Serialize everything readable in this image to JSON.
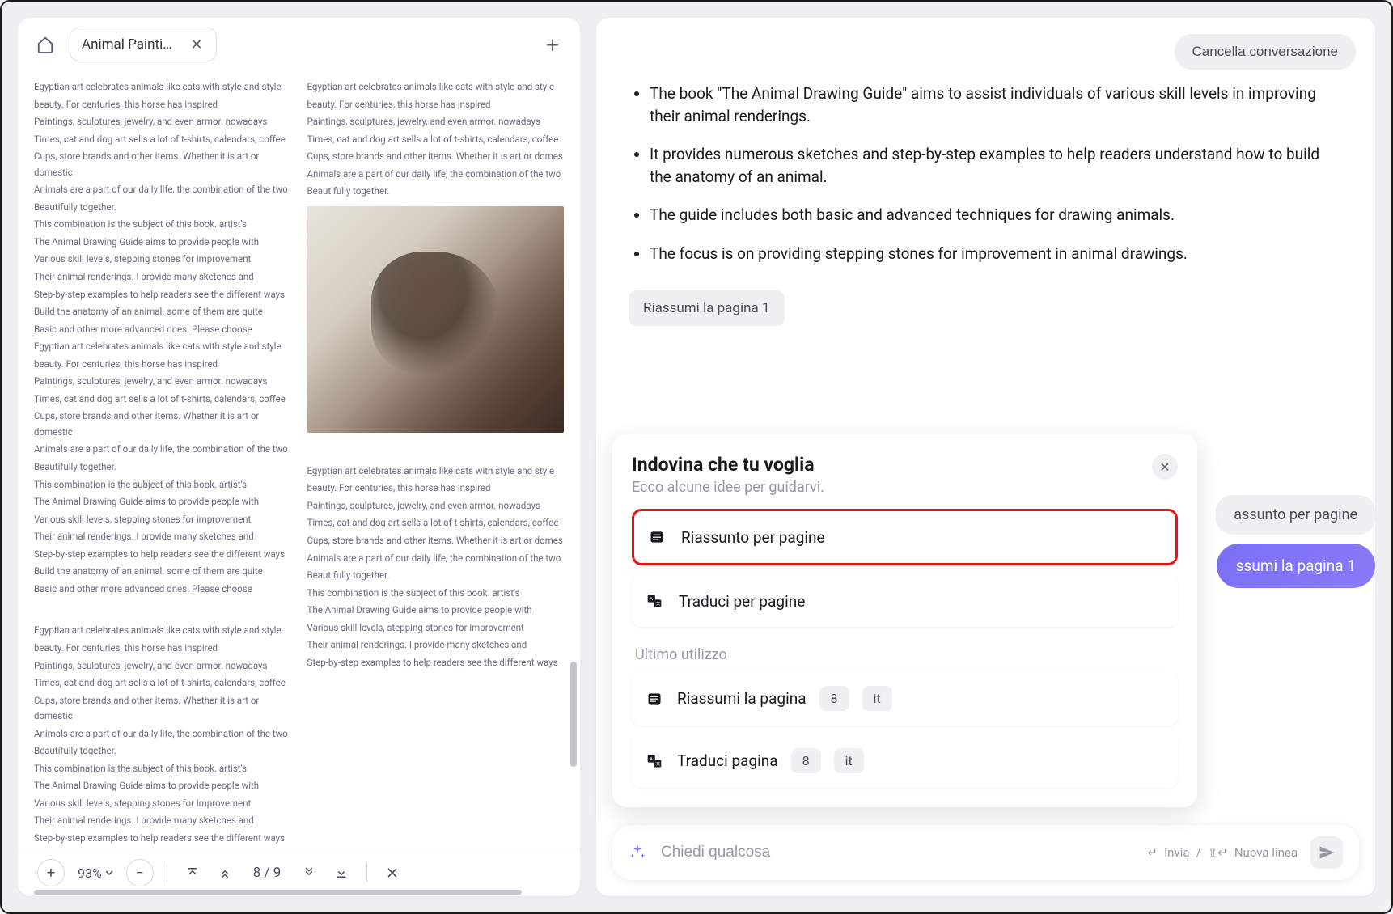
{
  "left": {
    "tab_title": "Animal Paintin...",
    "zoom": "93%",
    "page_current": "8",
    "page_separator": "/",
    "page_total": "9",
    "doc_lines_a": [
      "Egyptian art celebrates animals like cats with style and style",
      "beauty. For centuries, this horse has inspired",
      "Paintings, sculptures, jewelry, and even armor. nowadays",
      "Times, cat and dog art sells a lot of t-shirts, calendars, coffee",
      "Cups, store brands and other items. Whether it is art or domestic",
      "Animals are a part of our daily life, the combination of the two",
      "Beautifully together.",
      "This combination is the subject of this book. artist's",
      "The Animal Drawing Guide aims to provide people with",
      "Various skill levels, stepping stones for improvement",
      "Their animal renderings. I provide many sketches and",
      "Step-by-step examples to help readers see the different ways",
      "Build the anatomy of an animal. some of them are quite",
      "Basic and other more advanced ones. Please choose",
      "Egyptian art celebrates animals like cats with style and style",
      "beauty. For centuries, this horse has inspired",
      "Paintings, sculptures, jewelry, and even armor. nowadays",
      "Times, cat and dog art sells a lot of t-shirts, calendars, coffee",
      "Cups, store brands and other items. Whether it is art or domestic",
      "Animals are a part of our daily life, the combination of the two",
      "Beautifully together.",
      "This combination is the subject of this book. artist's",
      "The Animal Drawing Guide aims to provide people with",
      "Various skill levels, stepping stones for improvement",
      "Their animal renderings. I provide many sketches and",
      "Step-by-step examples to help readers see the different ways",
      "Build the anatomy of an animal. some of them are quite",
      "Basic and other more advanced ones. Please choose"
    ],
    "doc_lines_b": [
      "Egyptian art celebrates animals like cats with style and style",
      "beauty. For centuries, this horse has inspired",
      "Paintings, sculptures, jewelry, and even armor. nowadays",
      "Times, cat and dog art sells a lot of t-shirts, calendars, coffee",
      "Cups, store brands and other items. Whether it is art or domes",
      "Animals are a part of our daily life, the combination of the two",
      "Beautifully together."
    ],
    "doc_lines_c": [
      "Egyptian art celebrates animals like cats with style and style",
      "beauty. For centuries, this horse has inspired",
      "Paintings, sculptures, jewelry, and even armor. nowadays",
      "Times, cat and dog art sells a lot of t-shirts, calendars, coffee",
      "Cups, store brands and other items. Whether it is art or domestic",
      "Animals are a part of our daily life, the combination of the two",
      "Beautifully together.",
      "This combination is the subject of this book. artist's",
      "The Animal Drawing Guide aims to provide people with",
      "Various skill levels, stepping stones for improvement",
      "Their animal renderings. I provide many sketches and",
      "Step-by-step examples to help readers see the different ways"
    ],
    "doc_lines_d": [
      "Egyptian art celebrates animals like cats with style and style",
      "beauty. For centuries, this horse has inspired",
      "Paintings, sculptures, jewelry, and even armor. nowadays",
      "Times, cat and dog art sells a lot of t-shirts, calendars, coffee",
      "Cups, store brands and other items. Whether it is art or domes",
      "Animals are a part of our daily life, the combination of the two",
      "Beautifully together.",
      "This combination is the subject of this book. artist's",
      "The Animal Drawing Guide aims to provide people with",
      "Various skill levels, stepping stones for improvement",
      "Their animal renderings. I provide many sketches and",
      "Step-by-step examples to help readers see the different ways"
    ]
  },
  "right": {
    "cancel_label": "Cancella conversazione",
    "bullets": [
      "The book \"The Animal Drawing Guide\" aims to assist individuals of various skill levels in improving their animal renderings.",
      "It provides numerous sketches and step-by-step examples to help readers understand how to build the anatomy of an animal.",
      "The guide includes both basic and advanced techniques for drawing animals.",
      "The focus is on providing stepping stones for improvement in animal drawings."
    ],
    "chip_label": "Riassumi la pagina 1",
    "bg_pill_grey": "assunto per pagine",
    "bg_pill_purple": "ssumi la pagina 1",
    "popup": {
      "title": "Indovina che tu voglia",
      "subtitle": "Ecco alcune idee per guidarvi.",
      "item1": "Riassunto per pagine",
      "item2": "Traduci per pagine",
      "section_label": "Ultimo utilizzo",
      "recent1_label": "Riassumi la pagina",
      "recent1_badge1": "8",
      "recent1_badge2": "it",
      "recent2_label": "Traduci pagina",
      "recent2_badge1": "8",
      "recent2_badge2": "it"
    },
    "input": {
      "placeholder": "Chiedi qualcosa",
      "hint_send": "Invia",
      "hint_divider": "/",
      "hint_newline": "Nuova linea"
    }
  }
}
